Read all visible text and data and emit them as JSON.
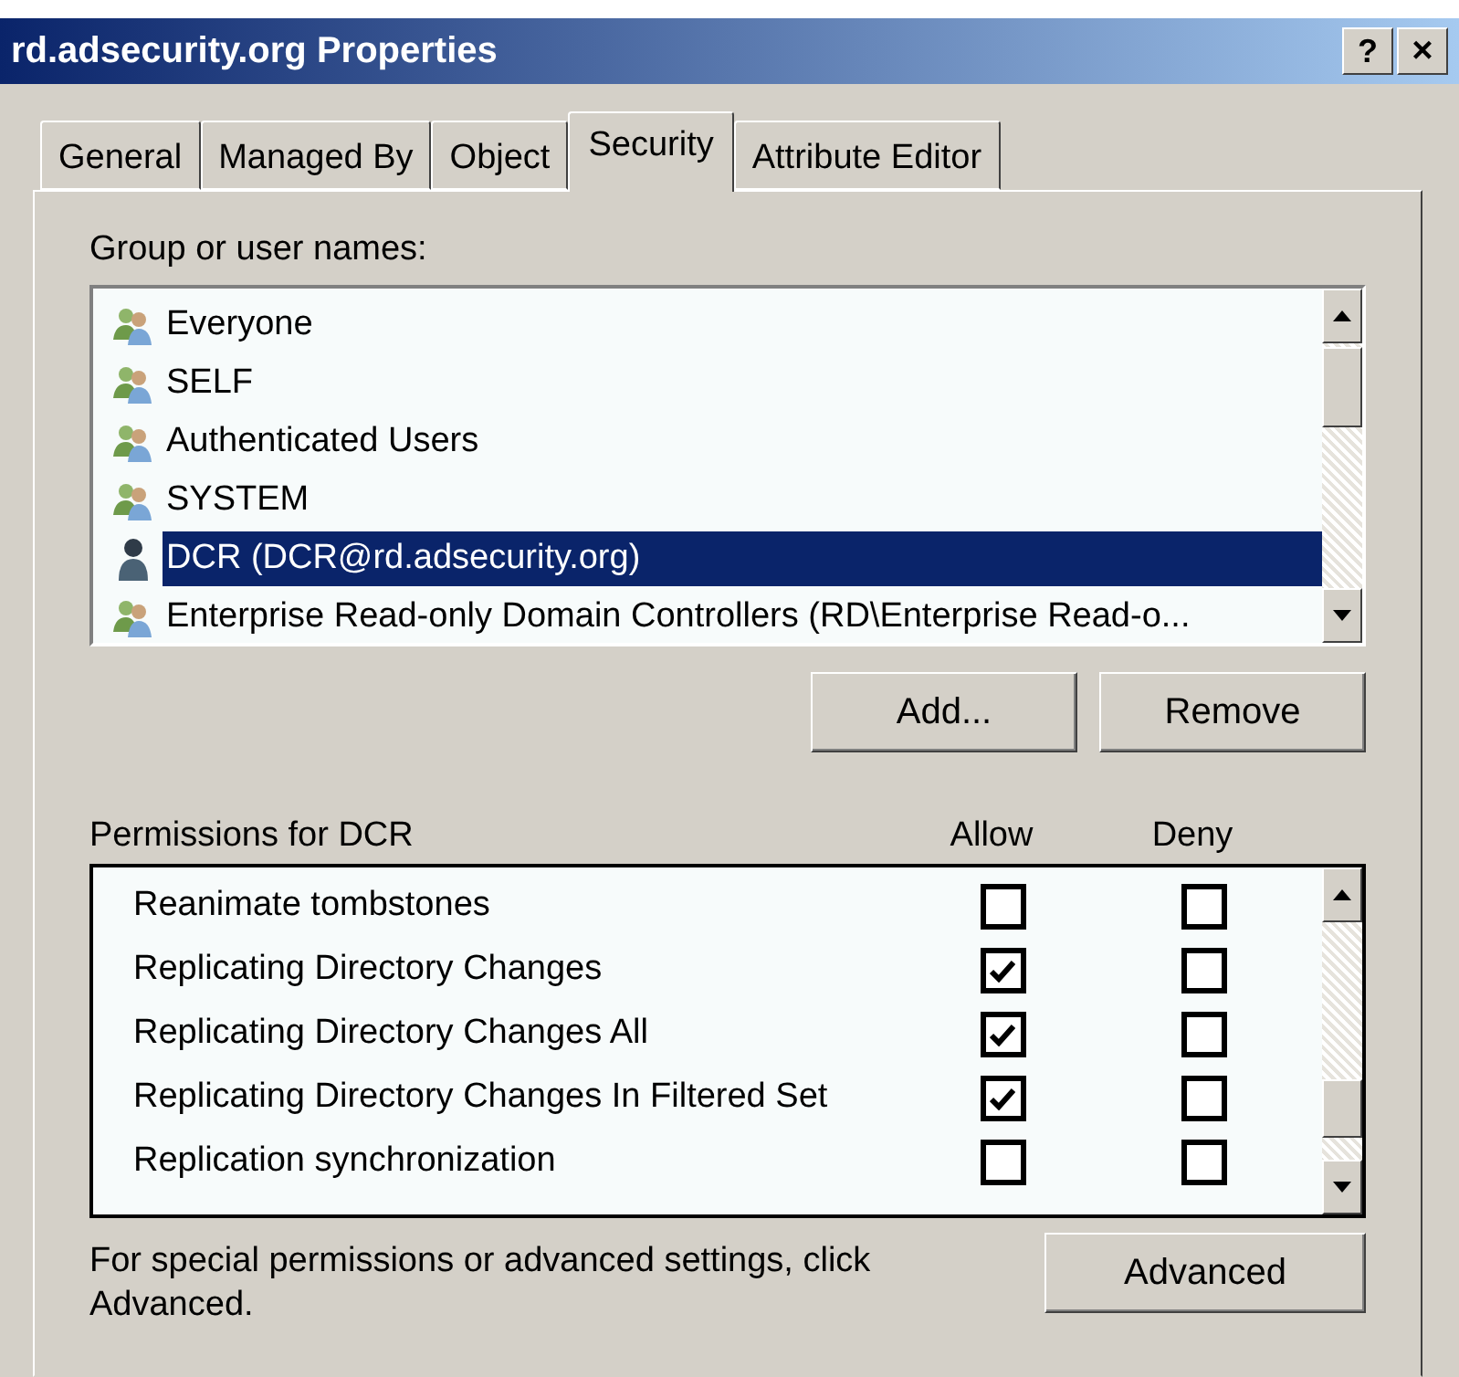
{
  "window": {
    "title": "rd.adsecurity.org Properties",
    "help_button": "?",
    "close_button": "×"
  },
  "tabs": [
    {
      "label": "General",
      "selected": false
    },
    {
      "label": "Managed By",
      "selected": false
    },
    {
      "label": "Object",
      "selected": false
    },
    {
      "label": "Security",
      "selected": true
    },
    {
      "label": "Attribute Editor",
      "selected": false
    }
  ],
  "principals": {
    "label": "Group or user names:",
    "items": [
      {
        "name": "Everyone",
        "kind": "group",
        "selected": false
      },
      {
        "name": "SELF",
        "kind": "group",
        "selected": false
      },
      {
        "name": "Authenticated Users",
        "kind": "group",
        "selected": false
      },
      {
        "name": "SYSTEM",
        "kind": "group",
        "selected": false
      },
      {
        "name": "DCR (DCR@rd.adsecurity.org)",
        "kind": "user",
        "selected": true
      },
      {
        "name": "Enterprise Read-only Domain Controllers (RD\\Enterprise Read-o...",
        "kind": "group",
        "selected": false
      }
    ],
    "buttons": [
      "Add...",
      "Remove"
    ]
  },
  "permissions": {
    "label": "Permissions for DCR",
    "allow_header": "Allow",
    "deny_header": "Deny",
    "rows": [
      {
        "name": "Reanimate tombstones",
        "allow": false,
        "deny": false
      },
      {
        "name": "Replicating Directory Changes",
        "allow": true,
        "deny": false
      },
      {
        "name": "Replicating Directory Changes All",
        "allow": true,
        "deny": false
      },
      {
        "name": "Replicating Directory Changes In Filtered Set",
        "allow": true,
        "deny": false
      },
      {
        "name": "Replication synchronization",
        "allow": false,
        "deny": false
      }
    ]
  },
  "footer": {
    "note": "For special permissions or advanced settings, click Advanced.",
    "button": "Advanced"
  }
}
